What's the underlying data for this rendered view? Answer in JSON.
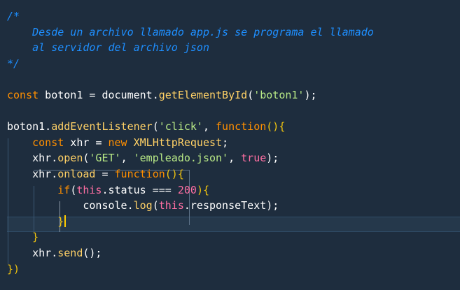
{
  "editor": {
    "theme_background": "#1e2d3e",
    "lines": [
      {
        "tokens": [
          {
            "t": "/*",
            "c": "cmt"
          }
        ]
      },
      {
        "tokens": [
          {
            "t": "    Desde un archivo llamado app.js se programa el llamado",
            "c": "cmt"
          }
        ]
      },
      {
        "tokens": [
          {
            "t": "    al servidor del archivo json",
            "c": "cmt"
          }
        ]
      },
      {
        "tokens": [
          {
            "t": "*/",
            "c": "cmt"
          }
        ]
      },
      {
        "tokens": []
      },
      {
        "tokens": [
          {
            "t": "const",
            "c": "kw2"
          },
          {
            "t": " boton1 ",
            "c": "id"
          },
          {
            "t": "=",
            "c": "op"
          },
          {
            "t": " document.",
            "c": "id"
          },
          {
            "t": "getElementById",
            "c": "fn"
          },
          {
            "t": "(",
            "c": "br"
          },
          {
            "t": "'boton1'",
            "c": "str"
          },
          {
            "t": ");",
            "c": "br"
          }
        ]
      },
      {
        "tokens": []
      },
      {
        "tokens": [
          {
            "t": "boton1.",
            "c": "id"
          },
          {
            "t": "addEventListener",
            "c": "fn"
          },
          {
            "t": "(",
            "c": "br"
          },
          {
            "t": "'click'",
            "c": "str"
          },
          {
            "t": ", ",
            "c": "op"
          },
          {
            "t": "function",
            "c": "kw2"
          },
          {
            "t": "(){",
            "c": "kw"
          }
        ]
      },
      {
        "tokens": [
          {
            "t": "    ",
            "c": "id"
          },
          {
            "t": "const",
            "c": "kw2"
          },
          {
            "t": " xhr ",
            "c": "id"
          },
          {
            "t": "=",
            "c": "op"
          },
          {
            "t": " new",
            "c": "kw2"
          },
          {
            "t": " XMLHttpRequest",
            "c": "fn"
          },
          {
            "t": ";",
            "c": "op"
          }
        ]
      },
      {
        "tokens": [
          {
            "t": "    xhr.",
            "c": "id"
          },
          {
            "t": "open",
            "c": "fn"
          },
          {
            "t": "(",
            "c": "br"
          },
          {
            "t": "'GET'",
            "c": "str"
          },
          {
            "t": ", ",
            "c": "op"
          },
          {
            "t": "'empleado.json'",
            "c": "str"
          },
          {
            "t": ", ",
            "c": "op"
          },
          {
            "t": "true",
            "c": "ct"
          },
          {
            "t": ");",
            "c": "br"
          }
        ]
      },
      {
        "tokens": [
          {
            "t": "    xhr.",
            "c": "id"
          },
          {
            "t": "onload",
            "c": "fn"
          },
          {
            "t": " = ",
            "c": "op"
          },
          {
            "t": "function",
            "c": "kw2"
          },
          {
            "t": "(){",
            "c": "kw"
          }
        ]
      },
      {
        "tokens": [
          {
            "t": "        ",
            "c": "id"
          },
          {
            "t": "if",
            "c": "kw2"
          },
          {
            "t": "(",
            "c": "br"
          },
          {
            "t": "this",
            "c": "ct"
          },
          {
            "t": ".status ",
            "c": "id"
          },
          {
            "t": "===",
            "c": "op"
          },
          {
            "t": " 200",
            "c": "num"
          },
          {
            "t": "){",
            "c": "kw"
          }
        ]
      },
      {
        "tokens": [
          {
            "t": "            console.",
            "c": "id"
          },
          {
            "t": "log",
            "c": "fn"
          },
          {
            "t": "(",
            "c": "br"
          },
          {
            "t": "this",
            "c": "ct"
          },
          {
            "t": ".responseText",
            "c": "id"
          },
          {
            "t": ");",
            "c": "br"
          }
        ]
      },
      {
        "tokens": [
          {
            "t": "        ",
            "c": "id"
          },
          {
            "t": "}",
            "c": "kw"
          }
        ],
        "cursor": true
      },
      {
        "tokens": [
          {
            "t": "    ",
            "c": "id"
          },
          {
            "t": "}",
            "c": "kw"
          }
        ]
      },
      {
        "tokens": [
          {
            "t": "    xhr.",
            "c": "id"
          },
          {
            "t": "send",
            "c": "fn"
          },
          {
            "t": "();",
            "c": "br"
          }
        ]
      },
      {
        "tokens": [
          {
            "t": "})",
            "c": "kw"
          }
        ]
      }
    ]
  }
}
